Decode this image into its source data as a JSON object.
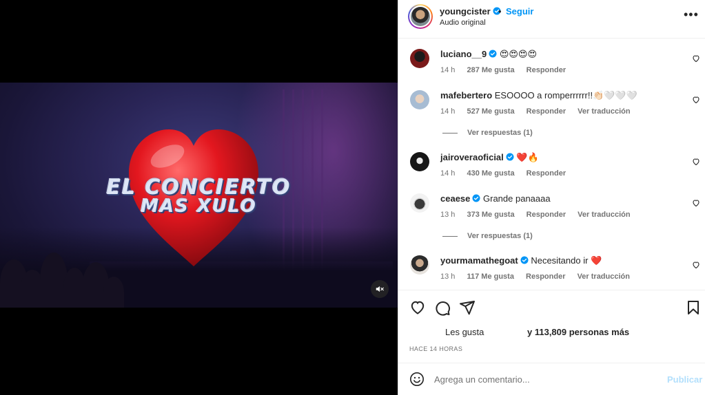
{
  "header": {
    "username": "youngcister",
    "separator": "•",
    "follow_label": "Seguir",
    "subtitle": "Audio original",
    "more_label": "•••"
  },
  "video": {
    "title_line1": "EL CONCIERTO",
    "title_line2": "MAS XULO",
    "muted": true
  },
  "comments": [
    {
      "username": "luciano__9",
      "verified": true,
      "text": "😍😍😍😍",
      "time": "14 h",
      "likes": "287 Me gusta",
      "reply_label": "Responder",
      "translate_label": "",
      "avatar_color": "#5b1414"
    },
    {
      "username": "mafebertero",
      "verified": false,
      "text": "ESOOOO a romperrrrrr!!👏🏻🤍🤍🤍",
      "time": "14 h",
      "likes": "527 Me gusta",
      "reply_label": "Responder",
      "translate_label": "Ver traducción",
      "avatar_color": "#c9d7e6"
    },
    {
      "username": "jairoveraoficial",
      "verified": true,
      "text": "❤️🔥",
      "time": "14 h",
      "likes": "430 Me gusta",
      "reply_label": "Responder",
      "translate_label": "",
      "avatar_color": "#1c1c1c"
    },
    {
      "username": "ceaese",
      "verified": true,
      "text": "Grande panaaaa",
      "time": "13 h",
      "likes": "373 Me gusta",
      "reply_label": "Responder",
      "translate_label": "Ver traducción",
      "avatar_color": "#2e2e2e"
    },
    {
      "username": "yourmamathegoat",
      "verified": true,
      "text": "Necesitando ir ❤️",
      "time": "13 h",
      "likes": "117 Me gusta",
      "reply_label": "Responder",
      "translate_label": "Ver traducción",
      "avatar_color": "#d9d3cc"
    }
  ],
  "view_replies": [
    "Ver respuestas (1)",
    "Ver respuestas (1)"
  ],
  "likes": {
    "prefix": "Les gusta",
    "rest": "y 113,809 personas más"
  },
  "timestamp": "Hace 14 horas",
  "add_comment": {
    "placeholder": "Agrega un comentario...",
    "post_label": "Publicar"
  },
  "colors": {
    "accent": "#0095f6",
    "verified": "#0095f6",
    "heart_red": "#ed1c24",
    "post_disabled": "#b2dffc",
    "muted_text": "#737373"
  },
  "icons": [
    "verified-badge-icon",
    "more-options-icon",
    "heart-outline-icon",
    "comment-icon",
    "share-icon",
    "bookmark-icon",
    "emoji-icon",
    "speaker-muted-icon"
  ]
}
